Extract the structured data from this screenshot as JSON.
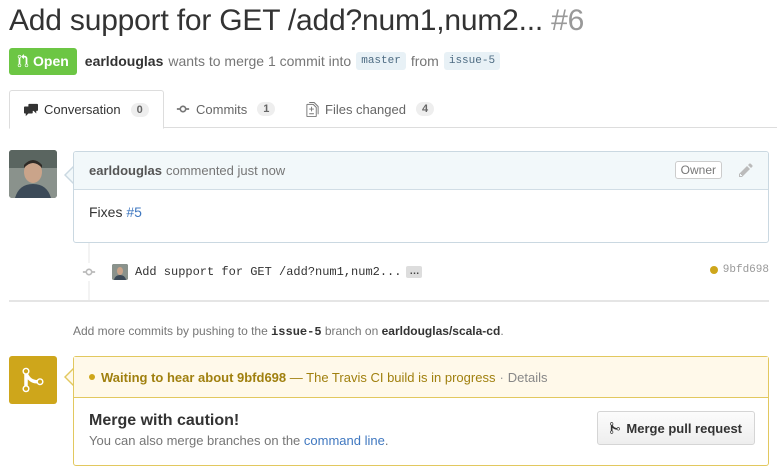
{
  "pr": {
    "title": "Add support for GET /add?num1,num2...",
    "number": "#6",
    "state": "Open",
    "author": "earldouglas",
    "merge_text": "wants to merge 1 commit into",
    "base_branch": "master",
    "from_text": "from",
    "head_branch": "issue-5"
  },
  "tabs": [
    {
      "label": "Conversation",
      "count": "0",
      "icon": "comment-discussion-icon"
    },
    {
      "label": "Commits",
      "count": "1",
      "icon": "git-commit-icon"
    },
    {
      "label": "Files changed",
      "count": "4",
      "icon": "diff-icon"
    }
  ],
  "comment": {
    "author": "earldouglas",
    "meta": "commented just now",
    "badge": "Owner",
    "body_text": "Fixes",
    "body_ref": "#5"
  },
  "commit": {
    "message": "Add support for GET /add?num1,num2...",
    "ellipsis": "…",
    "sha": "9bfd698"
  },
  "hint": {
    "prefix": "Add more commits by pushing to the",
    "branch": "issue-5",
    "middle": "branch on",
    "repo": "earldouglas/scala-cd",
    "suffix": "."
  },
  "merge": {
    "status_strong": "Waiting to hear about 9bfd698",
    "status_text": "— The Travis CI build is in progress",
    "separator": "·",
    "details_label": "Details",
    "heading": "Merge with caution!",
    "sub_prefix": "You can also merge branches on the",
    "sub_link": "command line",
    "sub_suffix": ".",
    "button_label": "Merge pull request"
  },
  "colors": {
    "open_green": "#6cc644",
    "pending_yellow": "#cea61b",
    "link_blue": "#4078c0"
  }
}
